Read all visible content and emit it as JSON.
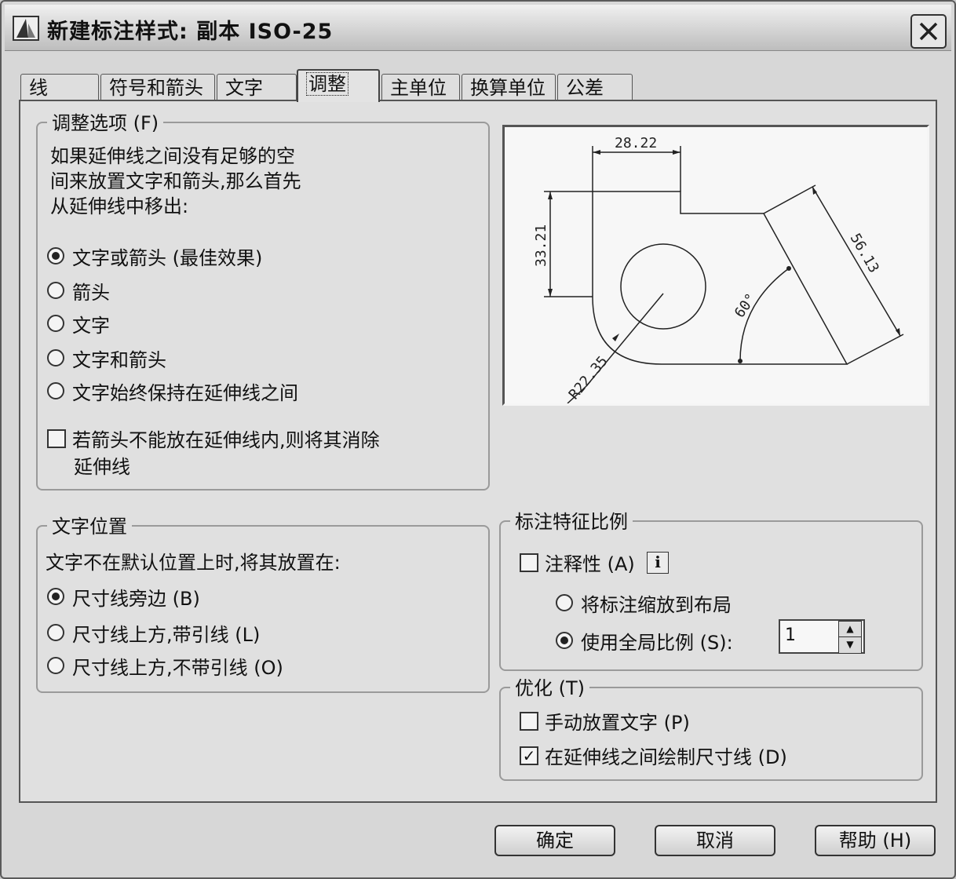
{
  "window": {
    "title": "新建标注样式: 副本 ISO-25"
  },
  "tabs": [
    {
      "label": "线"
    },
    {
      "label": "符号和箭头"
    },
    {
      "label": "文字"
    },
    {
      "label": "调整"
    },
    {
      "label": "主单位"
    },
    {
      "label": "换算单位"
    },
    {
      "label": "公差"
    }
  ],
  "fit_options": {
    "title": "调整选项 (F)",
    "desc_lines": [
      "如果延伸线之间没有足够的空",
      "间来放置文字和箭头,那么首先",
      "从延伸线中移出:"
    ],
    "radios": [
      {
        "label": "文字或箭头 (最佳效果)",
        "selected": true
      },
      {
        "label": "箭头",
        "selected": false
      },
      {
        "label": "文字",
        "selected": false
      },
      {
        "label": "文字和箭头",
        "selected": false
      },
      {
        "label": "文字始终保持在延伸线之间",
        "selected": false
      }
    ],
    "suppress_checkbox": {
      "line1": "若箭头不能放在延伸线内,则将其消除",
      "line2": "延伸线",
      "checked": false
    }
  },
  "preview": {
    "dim_top": "28.22",
    "dim_left": "33.21",
    "dim_diag": "56.13",
    "dim_angle": "60°",
    "dim_radius": "R22.35"
  },
  "text_placement": {
    "title": "文字位置",
    "desc": "文字不在默认位置上时,将其放置在:",
    "radios": [
      {
        "label": "尺寸线旁边 (B)",
        "selected": true
      },
      {
        "label": "尺寸线上方,带引线 (L)",
        "selected": false
      },
      {
        "label": "尺寸线上方,不带引线 (O)",
        "selected": false
      }
    ]
  },
  "scale": {
    "title": "标注特征比例",
    "annotative_label": "注释性 (A)",
    "annotative_checked": false,
    "info_icon": "i",
    "radio_layout": "将标注缩放到布局",
    "radio_global": "使用全局比例 (S):",
    "global_selected": true,
    "scale_value": "1"
  },
  "fine_tuning": {
    "title": "优化 (T)",
    "manual_label": "手动放置文字 (P)",
    "manual_checked": false,
    "draw_label": "在延伸线之间绘制尺寸线 (D)",
    "draw_checked": true,
    "check_mark": "✓"
  },
  "buttons": {
    "ok": "确定",
    "cancel": "取消",
    "help": "帮助 (H)"
  },
  "icons": {
    "app": "autocad-icon",
    "close": "close-icon"
  }
}
